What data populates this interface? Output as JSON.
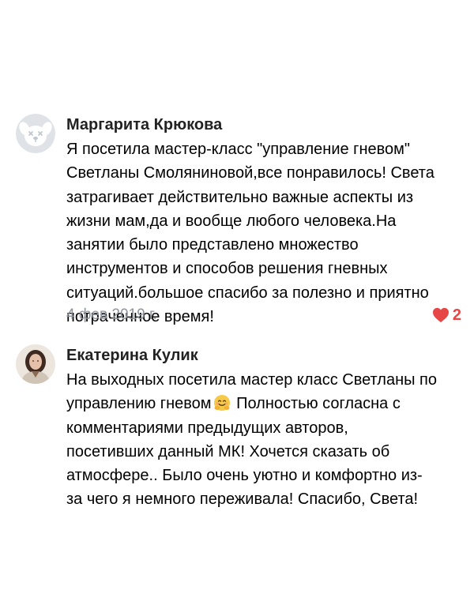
{
  "comments": [
    {
      "author": "Маргарита Крюкова",
      "avatar_icon": "dog-deactivated-avatar-icon",
      "lines": [
        "Я посетила мастер-класс \"управление гневом\"",
        "Светланы Смоляниновой,все понравилось! Света",
        "затрагивает действительно важные аспекты из",
        "жизни мам,да и вообще любого человека.На",
        "занятии было представлено множество",
        "инструментов и способов решения гневных",
        "ситуаций.большое спасибо за полезно и приятно",
        "потраченное время!"
      ],
      "date": "4 фев 2019 г.",
      "likes": "2",
      "like_icon": "heart-icon",
      "like_color": "#e64646"
    },
    {
      "author": "Екатерина Кулик",
      "avatar_icon": "user-photo-avatar",
      "lines": [
        "На выходных посетила мастер класс Светланы по",
        "управлению гневом",
        "Полностью согласна с",
        "комментариями предыдущих авторов,",
        "посетивших данный МК! Хочется сказать об",
        "атмосфере.. Было очень уютно и комфортно из-",
        "за чего я немного переживала! Спасибо, Света!"
      ],
      "emoji_icon": "hugging-face-emoji-icon"
    }
  ],
  "colors": {
    "text": "#000000",
    "author": "#222222",
    "date": "#8f949c",
    "like": "#e64646"
  }
}
